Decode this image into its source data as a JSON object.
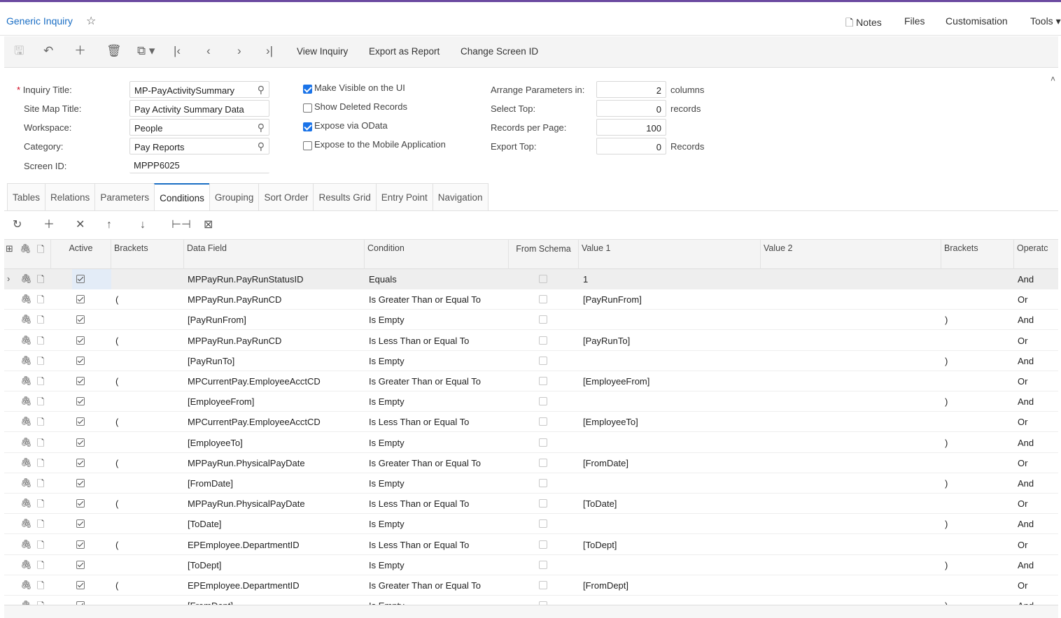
{
  "header": {
    "title": "Generic Inquiry",
    "star_icon": "star-icon",
    "menu": [
      "Notes",
      "Files",
      "Customisation",
      "Tools"
    ]
  },
  "toolbar": {
    "view_inquiry": "View Inquiry",
    "export_report": "Export as Report",
    "change_screen_id": "Change Screen ID"
  },
  "form": {
    "inquiry_title_label": "Inquiry Title:",
    "inquiry_title_value": "MP-PayActivitySummary",
    "site_map_title_label": "Site Map Title:",
    "site_map_title_value": "Pay Activity Summary Data",
    "workspace_label": "Workspace:",
    "workspace_value": "People",
    "category_label": "Category:",
    "category_value": "Pay Reports",
    "screen_id_label": "Screen ID:",
    "screen_id_value": "MPPP6025",
    "make_visible_label": "Make Visible on the UI",
    "make_visible_checked": true,
    "show_deleted_label": "Show Deleted Records",
    "show_deleted_checked": false,
    "expose_odata_label": "Expose via OData",
    "expose_odata_checked": true,
    "expose_mobile_label": "Expose to the Mobile Application",
    "expose_mobile_checked": false,
    "arrange_label": "Arrange Parameters in:",
    "arrange_value": "2",
    "arrange_unit": "columns",
    "select_top_label": "Select Top:",
    "select_top_value": "0",
    "select_top_unit": "records",
    "records_per_page_label": "Records per Page:",
    "records_per_page_value": "100",
    "export_top_label": "Export Top:",
    "export_top_value": "0",
    "export_top_unit": "Records"
  },
  "tabs": [
    "Tables",
    "Relations",
    "Parameters",
    "Conditions",
    "Grouping",
    "Sort Order",
    "Results Grid",
    "Entry Point",
    "Navigation"
  ],
  "active_tab": "Conditions",
  "grid": {
    "headers": {
      "active": "Active",
      "brackets": "Brackets",
      "data_field": "Data Field",
      "condition": "Condition",
      "from_schema": "From Schema",
      "value1": "Value 1",
      "value2": "Value 2",
      "brackets2": "Brackets",
      "operator": "Operatc"
    },
    "rows": [
      {
        "open": "",
        "field": "MPPayRun.PayRunStatusID",
        "condition": "Equals",
        "value1": "1",
        "value2": "",
        "close": "",
        "op": "And"
      },
      {
        "open": "(",
        "field": "MPPayRun.PayRunCD",
        "condition": "Is Greater Than or Equal To",
        "value1": "[PayRunFrom]",
        "value2": "",
        "close": "",
        "op": "Or"
      },
      {
        "open": "",
        "field": "[PayRunFrom]",
        "condition": "Is Empty",
        "value1": "",
        "value2": "",
        "close": ")",
        "op": "And"
      },
      {
        "open": "(",
        "field": "MPPayRun.PayRunCD",
        "condition": "Is Less Than or Equal To",
        "value1": "[PayRunTo]",
        "value2": "",
        "close": "",
        "op": "Or"
      },
      {
        "open": "",
        "field": "[PayRunTo]",
        "condition": "Is Empty",
        "value1": "",
        "value2": "",
        "close": ")",
        "op": "And"
      },
      {
        "open": "(",
        "field": "MPCurrentPay.EmployeeAcctCD",
        "condition": "Is Greater Than or Equal To",
        "value1": "[EmployeeFrom]",
        "value2": "",
        "close": "",
        "op": "Or"
      },
      {
        "open": "",
        "field": "[EmployeeFrom]",
        "condition": "Is Empty",
        "value1": "",
        "value2": "",
        "close": ")",
        "op": "And"
      },
      {
        "open": "(",
        "field": "MPCurrentPay.EmployeeAcctCD",
        "condition": "Is Less Than or Equal To",
        "value1": "[EmployeeTo]",
        "value2": "",
        "close": "",
        "op": "Or"
      },
      {
        "open": "",
        "field": "[EmployeeTo]",
        "condition": "Is Empty",
        "value1": "",
        "value2": "",
        "close": ")",
        "op": "And"
      },
      {
        "open": "(",
        "field": "MPPayRun.PhysicalPayDate",
        "condition": "Is Greater Than or Equal To",
        "value1": "[FromDate]",
        "value2": "",
        "close": "",
        "op": "Or"
      },
      {
        "open": "",
        "field": "[FromDate]",
        "condition": "Is Empty",
        "value1": "",
        "value2": "",
        "close": ")",
        "op": "And"
      },
      {
        "open": "(",
        "field": "MPPayRun.PhysicalPayDate",
        "condition": "Is Less Than or Equal To",
        "value1": "[ToDate]",
        "value2": "",
        "close": "",
        "op": "Or"
      },
      {
        "open": "",
        "field": "[ToDate]",
        "condition": "Is Empty",
        "value1": "",
        "value2": "",
        "close": ")",
        "op": "And"
      },
      {
        "open": "(",
        "field": "EPEmployee.DepartmentID",
        "condition": "Is Less Than or Equal To",
        "value1": "[ToDept]",
        "value2": "",
        "close": "",
        "op": "Or"
      },
      {
        "open": "",
        "field": "[ToDept]",
        "condition": "Is Empty",
        "value1": "",
        "value2": "",
        "close": ")",
        "op": "And"
      },
      {
        "open": "(",
        "field": "EPEmployee.DepartmentID",
        "condition": "Is Greater Than or Equal To",
        "value1": "[FromDept]",
        "value2": "",
        "close": "",
        "op": "Or"
      },
      {
        "open": "",
        "field": "[FromDept]",
        "condition": "Is Empty",
        "value1": "",
        "value2": "",
        "close": ")",
        "op": "And"
      }
    ]
  }
}
